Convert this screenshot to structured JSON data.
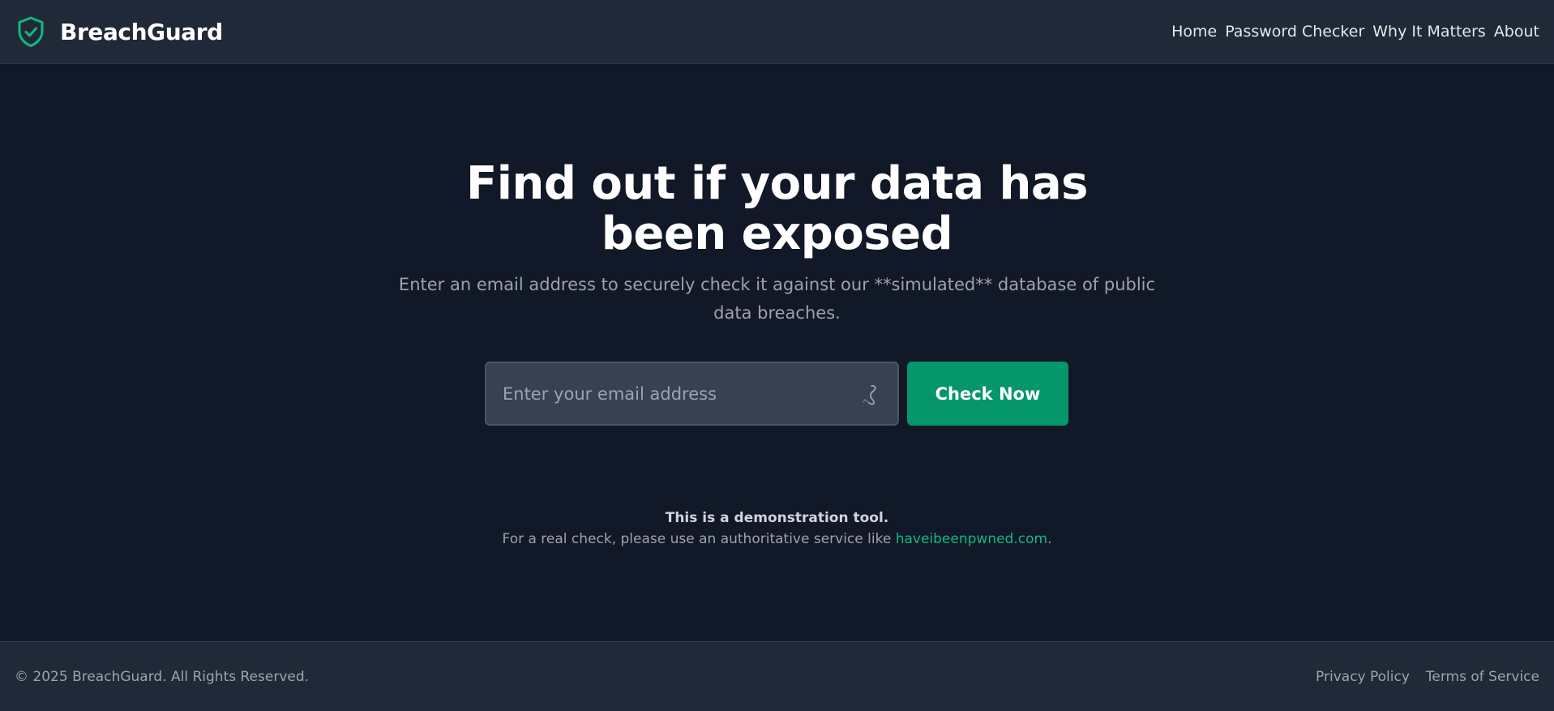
{
  "header": {
    "brand": "BreachGuard",
    "logo_icon": "shield-check-icon",
    "nav": [
      {
        "label": "Home"
      },
      {
        "label": "Password Checker"
      },
      {
        "label": "Why It Matters"
      },
      {
        "label": "About"
      }
    ]
  },
  "hero": {
    "title": "Find out if your data has been exposed",
    "subtitle": "Enter an email address to securely check it against our **simulated** database of public data breaches."
  },
  "search": {
    "placeholder": "Enter your email address",
    "value": "",
    "button_label": "Check Now",
    "field_icon": "hook-icon"
  },
  "notice": {
    "title": "This is a demonstration tool.",
    "text_before": "For a real check, please use an authoritative service like ",
    "link_text": "haveibeenpwned.com",
    "text_after": "."
  },
  "footer": {
    "copyright": "© 2025 BreachGuard. All Rights Reserved.",
    "links": [
      {
        "label": "Privacy Policy"
      },
      {
        "label": "Terms of Service"
      }
    ]
  },
  "colors": {
    "background": "#111827",
    "surface": "#1f2937",
    "accent": "#059669",
    "link": "#10b981"
  }
}
